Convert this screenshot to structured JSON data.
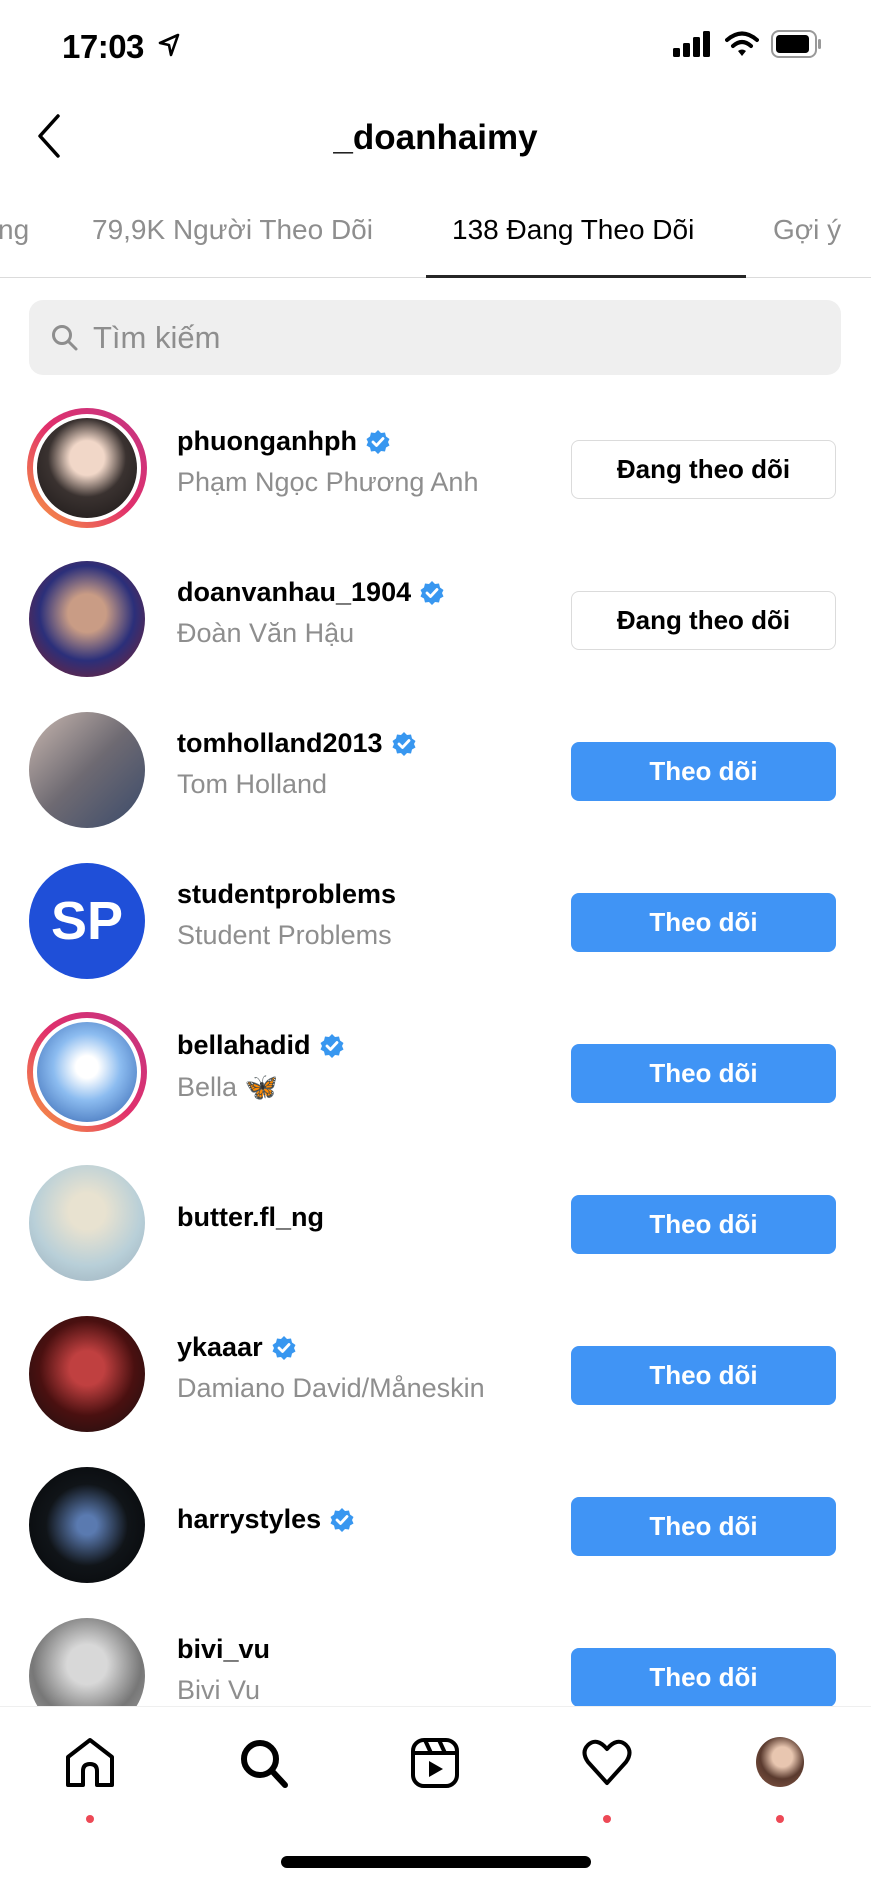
{
  "status_bar": {
    "time": "17:03",
    "icons": [
      "location-arrow-icon",
      "signal-icon",
      "wifi-icon",
      "battery-icon"
    ]
  },
  "header": {
    "title": "_doanhaimy",
    "back_icon": "chevron-left-icon"
  },
  "tabs": [
    {
      "label": "ng",
      "active": false
    },
    {
      "label": "79,9K Người Theo Dõi",
      "active": false
    },
    {
      "label": "138 Đang Theo Dõi",
      "active": true
    },
    {
      "label": "Gợi ý",
      "active": false
    }
  ],
  "search": {
    "placeholder": "Tìm kiếm",
    "value": ""
  },
  "colors": {
    "accent": "#4094f5",
    "verified": "#3897f0",
    "notification_dot": "#ed4956"
  },
  "users": [
    {
      "username": "phuonganhph",
      "name": "Phạm Ngọc Phương Anh",
      "verified": true,
      "story_ring": true,
      "button": "Đang theo dõi",
      "state": "following"
    },
    {
      "username": "doanvanhau_1904",
      "name": "Đoàn Văn Hậu",
      "verified": true,
      "story_ring": false,
      "button": "Đang theo dõi",
      "state": "following"
    },
    {
      "username": "tomholland2013",
      "name": "Tom Holland",
      "verified": true,
      "story_ring": false,
      "button": "Theo dõi",
      "state": "follow"
    },
    {
      "username": "studentproblems",
      "name": "Student Problems",
      "verified": false,
      "story_ring": false,
      "button": "Theo dõi",
      "state": "follow",
      "avatar_text": "SP"
    },
    {
      "username": "bellahadid",
      "name": "Bella 🦋",
      "verified": true,
      "story_ring": true,
      "button": "Theo dõi",
      "state": "follow"
    },
    {
      "username": "butter.fl_ng",
      "name": "",
      "verified": false,
      "story_ring": false,
      "button": "Theo dõi",
      "state": "follow"
    },
    {
      "username": "ykaaar",
      "name": "Damiano David/Måneskin",
      "verified": true,
      "story_ring": false,
      "button": "Theo dõi",
      "state": "follow"
    },
    {
      "username": "harrystyles",
      "name": "",
      "verified": true,
      "story_ring": false,
      "button": "Theo dõi",
      "state": "follow"
    },
    {
      "username": "bivi_vu",
      "name": "Bivi Vu",
      "verified": false,
      "story_ring": false,
      "button": "Theo dõi",
      "state": "follow"
    }
  ],
  "bottom_nav": [
    {
      "icon": "home-icon",
      "dot": true
    },
    {
      "icon": "search-icon",
      "dot": false
    },
    {
      "icon": "reels-icon",
      "dot": false
    },
    {
      "icon": "heart-icon",
      "dot": true
    },
    {
      "icon": "profile-avatar",
      "dot": true
    }
  ]
}
